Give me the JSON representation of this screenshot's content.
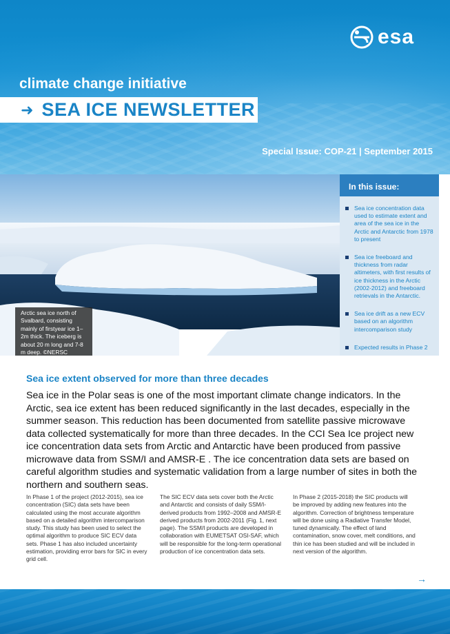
{
  "header": {
    "logo_text": "esa",
    "cci_label": "climate change initiative",
    "newsletter_title": "SEA ICE NEWSLETTER",
    "title_arrow_icon": "arrow-right-icon",
    "issue_label": "Special Issue: COP-21 | September 2015",
    "colors": {
      "band": "#1390d2",
      "title": "#1a84c6"
    }
  },
  "photo": {
    "caption": "Arctic sea ice north of Svalbard, consisting mainly of firstyear ice 1–2m thick. The iceberg is about 20 m long and 7-8 m deep. ©NERSC"
  },
  "in_this_issue": {
    "heading": "In this issue:",
    "items": [
      "Sea ice concentration data used to estimate extent and area of the sea ice in the Arctic and Antarctic from 1978 to present",
      "Sea ice freeboard and thickness from radar altimeters, with first results of ice thickness in the Arctic (2002-2012) and freeboard retrievals in the Antarctic.",
      "Sea ice drift as a new ECV based on an algorithm intercomparison study",
      "Expected results in Phase 2"
    ]
  },
  "article": {
    "title": "Sea ice extent observed for more than three decades",
    "lead": "Sea ice in the Polar seas is one of the most important climate change indicators. In the Arctic, sea ice extent has been reduced significantly in the last decades, especially in the summer season. This reduction has been documented from satellite passive microwave data collected systematically for more than three decades. In the CCI Sea Ice project new ice concentration data sets from Arctic and Antarctic have been produced from passive microwave data from SSM/I and AMSR-E . The ice concentration data sets are based on careful algorithm studies and systematic validation from a large number of sites in both the northern and southern seas.",
    "columns": [
      "In Phase 1 of the project (2012-2015), sea ice concentration (SIC) data sets have been calculated using the most accurate algorithm based on a detailed algorithm intercomparison study. This study has been used to select the optimal algorithm to produce SIC ECV data sets. Phase 1 has also included uncertainty estimation, providing error bars for SIC in every grid cell.",
      "The SIC ECV data sets cover both the Arctic and Antarctic and consists of daily SSM/I-derived products from 1992–2008 and AMSR-E derived products from 2002-2011 (Fig. 1, next page). The SSM/I products are developed in collaboration with EUMETSAT OSI-SAF, which will be responsible for the long-term operational production of ice concentration data sets.",
      "In Phase 2 (2015-2018) the SIC products will be improved by adding new features into the algorithm. Correction of brightness temperature will be done using a Radiative Transfer Model, tuned dynamically. The effect of land contamination, snow cover, melt conditions, and thin ice has been studied and will be included in next version of the algorithm."
    ],
    "next_arrow": "→"
  }
}
